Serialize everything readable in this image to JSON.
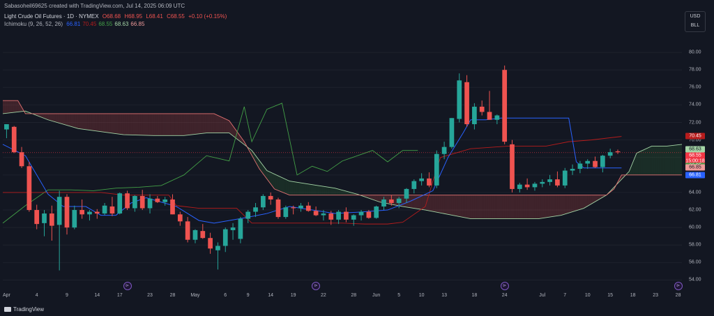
{
  "header": {
    "attribution": "Sabasoheil69625 created with TradingView.com, Jul 14, 2025 06:09 UTC"
  },
  "legend": {
    "symbol": "Light Crude Oil Futures · 1D · NYMEX",
    "open": "O68.68",
    "high": "H68.95",
    "low": "L68.41",
    "close": "C68.55",
    "change": "+0.10 (+0.15%)",
    "indicator": "Ichimoku (9, 26, 52, 26)",
    "ichi_values": [
      {
        "text": "66.81",
        "color": "#2962ff"
      },
      {
        "text": "70.45",
        "color": "#b71c1c"
      },
      {
        "text": "68.55",
        "color": "#43a047"
      },
      {
        "text": "68.63",
        "color": "#a5d6a7"
      },
      {
        "text": "66.85",
        "color": "#ef9a9a"
      }
    ]
  },
  "currency": {
    "unit": "USD",
    "sub": "BLL"
  },
  "price_axis": {
    "ticks": [
      "80.00",
      "78.00",
      "76.00",
      "74.00",
      "72.00",
      "70.00",
      "68.00",
      "66.00",
      "64.00",
      "62.00",
      "60.00",
      "58.00",
      "56.00",
      "54.00"
    ]
  },
  "price_badges": [
    {
      "text": "70.45",
      "value": 70.45,
      "color": "#b71c1c",
      "dark": false
    },
    {
      "text": "68.63",
      "value": 68.9,
      "color": "#a5d6a7",
      "dark": true
    },
    {
      "text": "68.55",
      "value": 68.2,
      "color": "#f23645",
      "dark": false
    },
    {
      "text": "15:00:18",
      "value": 67.55,
      "color": "#f23645",
      "dark": false
    },
    {
      "text": "68.55",
      "value": 67.0,
      "color": "#43a047",
      "dark": false
    },
    {
      "text": "66.85",
      "value": 66.85,
      "color": "#ef9a9a",
      "dark": true
    },
    {
      "text": "66.81",
      "value": 66.0,
      "color": "#2962ff",
      "dark": false
    }
  ],
  "time_axis": {
    "labels": [
      {
        "text": "Apr",
        "x": 0
      },
      {
        "text": "4",
        "x": 4
      },
      {
        "text": "9",
        "x": 8
      },
      {
        "text": "14",
        "x": 12
      },
      {
        "text": "17",
        "x": 15
      },
      {
        "text": "23",
        "x": 19
      },
      {
        "text": "28",
        "x": 22
      },
      {
        "text": "May",
        "x": 25
      },
      {
        "text": "6",
        "x": 29
      },
      {
        "text": "9",
        "x": 32
      },
      {
        "text": "14",
        "x": 35
      },
      {
        "text": "19",
        "x": 38
      },
      {
        "text": "22",
        "x": 42
      },
      {
        "text": "28",
        "x": 46
      },
      {
        "text": "Jun",
        "x": 49
      },
      {
        "text": "5",
        "x": 52
      },
      {
        "text": "10",
        "x": 55
      },
      {
        "text": "13",
        "x": 58
      },
      {
        "text": "18",
        "x": 62
      },
      {
        "text": "24",
        "x": 66
      },
      {
        "text": "Jul",
        "x": 71
      },
      {
        "text": "7",
        "x": 74
      },
      {
        "text": "10",
        "x": 77
      },
      {
        "text": "15",
        "x": 80
      },
      {
        "text": "18",
        "x": 83
      },
      {
        "text": "23",
        "x": 86
      },
      {
        "text": "28",
        "x": 89
      }
    ]
  },
  "footer": {
    "brand": "TradingView"
  },
  "chart_data": {
    "type": "candlestick",
    "x_index_range": [
      0,
      90
    ],
    "ylim": [
      53,
      82
    ],
    "candles": [
      [
        71.2,
        71.8,
        70.2,
        71.8
      ],
      [
        71.5,
        71.6,
        68.5,
        68.6
      ],
      [
        68.6,
        69.2,
        66.8,
        67.0
      ],
      [
        67.0,
        67.5,
        61.8,
        62.0
      ],
      [
        62.0,
        62.6,
        59.8,
        60.4
      ],
      [
        60.5,
        62.0,
        59.0,
        61.6
      ],
      [
        61.6,
        62.5,
        58.5,
        60.2
      ],
      [
        60.3,
        64.2,
        55.1,
        63.5
      ],
      [
        63.5,
        63.8,
        59.2,
        60.0
      ],
      [
        60.0,
        62.5,
        59.8,
        62.0
      ],
      [
        62.0,
        63.2,
        61.0,
        61.5
      ],
      [
        61.5,
        62.0,
        60.8,
        61.8
      ],
      [
        61.8,
        62.1,
        61.0,
        61.6
      ],
      [
        61.6,
        62.8,
        61.4,
        62.5
      ],
      [
        62.4,
        63.5,
        61.3,
        61.6
      ],
      [
        61.6,
        64.0,
        61.5,
        63.9
      ],
      [
        63.9,
        64.2,
        62.0,
        62.2
      ],
      [
        62.2,
        63.7,
        61.8,
        63.6
      ],
      [
        63.6,
        64.3,
        62.0,
        62.2
      ],
      [
        62.2,
        63.8,
        61.6,
        63.3
      ],
      [
        63.3,
        63.6,
        62.8,
        62.9
      ],
      [
        62.9,
        63.5,
        62.5,
        63.2
      ],
      [
        63.2,
        63.8,
        61.5,
        61.5
      ],
      [
        61.5,
        61.8,
        60.2,
        60.7
      ],
      [
        60.7,
        61.2,
        58.3,
        58.6
      ],
      [
        58.6,
        59.8,
        58.2,
        59.7
      ],
      [
        59.6,
        60.4,
        58.7,
        58.8
      ],
      [
        58.8,
        59.4,
        57.0,
        57.6
      ],
      [
        57.4,
        58.3,
        55.2,
        57.9
      ],
      [
        57.9,
        60.0,
        57.2,
        59.8
      ],
      [
        59.7,
        60.5,
        58.6,
        60.0
      ],
      [
        58.7,
        61.2,
        58.2,
        61.0
      ],
      [
        61.0,
        62.0,
        60.5,
        61.8
      ],
      [
        61.8,
        62.8,
        61.2,
        62.3
      ],
      [
        62.3,
        63.8,
        62.0,
        63.6
      ],
      [
        63.6,
        64.0,
        62.6,
        63.2
      ],
      [
        63.2,
        63.4,
        61.0,
        61.2
      ],
      [
        61.2,
        62.5,
        61.0,
        62.3
      ],
      [
        62.3,
        62.5,
        61.5,
        62.2
      ],
      [
        62.2,
        62.8,
        61.8,
        62.5
      ],
      [
        62.5,
        62.9,
        61.8,
        61.9
      ],
      [
        61.9,
        62.4,
        61.3,
        61.4
      ],
      [
        61.4,
        62.0,
        60.8,
        61.6
      ],
      [
        61.6,
        61.9,
        60.3,
        60.9
      ],
      [
        60.9,
        62.0,
        60.4,
        61.8
      ],
      [
        61.8,
        62.3,
        60.6,
        60.9
      ],
      [
        60.9,
        61.5,
        60.2,
        61.4
      ],
      [
        61.4,
        62.0,
        60.8,
        61.8
      ],
      [
        61.8,
        62.0,
        61.0,
        61.1
      ],
      [
        61.1,
        62.5,
        61.0,
        62.4
      ],
      [
        62.4,
        63.5,
        62.0,
        63.2
      ],
      [
        63.2,
        63.7,
        62.5,
        62.8
      ],
      [
        62.8,
        63.5,
        62.2,
        63.3
      ],
      [
        63.3,
        64.5,
        62.8,
        64.4
      ],
      [
        64.4,
        65.5,
        63.9,
        65.3
      ],
      [
        65.3,
        66.2,
        64.8,
        65.6
      ],
      [
        65.6,
        66.3,
        64.6,
        64.8
      ],
      [
        64.8,
        68.8,
        64.5,
        68.4
      ],
      [
        68.4,
        69.8,
        67.8,
        69.2
      ],
      [
        69.2,
        72.5,
        69.0,
        72.5
      ],
      [
        72.4,
        77.6,
        72.0,
        76.8
      ],
      [
        76.6,
        77.4,
        71.5,
        71.8
      ],
      [
        71.8,
        74.2,
        71.2,
        73.8
      ],
      [
        73.8,
        74.5,
        72.8,
        73.2
      ],
      [
        73.2,
        75.6,
        72.8,
        72.3
      ],
      [
        72.3,
        72.9,
        71.8,
        72.8
      ],
      [
        78.0,
        78.5,
        69.5,
        69.8
      ],
      [
        69.5,
        70.0,
        64.0,
        64.4
      ],
      [
        64.4,
        65.1,
        64.0,
        64.9
      ],
      [
        64.9,
        65.6,
        64.3,
        64.6
      ],
      [
        64.6,
        65.2,
        64.2,
        65.0
      ],
      [
        65.0,
        65.5,
        64.6,
        65.2
      ],
      [
        65.2,
        66.0,
        64.8,
        65.5
      ],
      [
        65.5,
        66.4,
        64.6,
        64.8
      ],
      [
        64.8,
        66.8,
        64.5,
        66.5
      ],
      [
        66.5,
        67.2,
        66.0,
        66.7
      ],
      [
        66.7,
        67.6,
        66.2,
        67.3
      ],
      [
        67.3,
        67.8,
        66.7,
        67.6
      ],
      [
        67.6,
        68.1,
        66.8,
        66.9
      ],
      [
        66.9,
        68.3,
        66.3,
        68.2
      ],
      [
        68.2,
        69.0,
        67.9,
        68.6
      ],
      [
        68.7,
        68.9,
        68.4,
        68.6
      ]
    ],
    "tenkan_sen": [
      [
        0,
        69.5
      ],
      [
        3,
        68.2
      ],
      [
        6,
        63.8
      ],
      [
        8,
        62.4
      ],
      [
        11,
        62.4
      ],
      [
        13,
        61.4
      ],
      [
        15,
        61.4
      ],
      [
        17,
        62.8
      ],
      [
        19,
        63.4
      ],
      [
        21,
        62.9
      ],
      [
        23,
        62.4
      ],
      [
        26,
        60.8
      ],
      [
        28,
        60.5
      ],
      [
        30,
        60.8
      ],
      [
        32,
        61.1
      ],
      [
        35,
        61.6
      ],
      [
        38,
        62.4
      ],
      [
        41,
        62.0
      ],
      [
        44,
        61.6
      ],
      [
        48,
        61.8
      ],
      [
        51,
        62.0
      ],
      [
        54,
        63.0
      ],
      [
        57,
        64.2
      ],
      [
        59,
        68.0
      ],
      [
        61,
        70.8
      ],
      [
        62,
        72.3
      ],
      [
        64,
        72.3
      ],
      [
        66,
        72.5
      ],
      [
        68,
        72.5
      ],
      [
        71,
        72.5
      ],
      [
        73,
        72.5
      ],
      [
        75,
        72.5
      ],
      [
        76,
        67.5
      ],
      [
        77,
        66.8
      ],
      [
        80,
        66.8
      ],
      [
        82,
        66.8
      ]
    ],
    "kijun_sen": [
      [
        0,
        64.0
      ],
      [
        13,
        64.0
      ],
      [
        16,
        63.7
      ],
      [
        22,
        63.7
      ],
      [
        23,
        62.5
      ],
      [
        26,
        62.2
      ],
      [
        31,
        62.2
      ],
      [
        33,
        60.5
      ],
      [
        38,
        60.5
      ],
      [
        45,
        60.5
      ],
      [
        48,
        60.4
      ],
      [
        51,
        60.4
      ],
      [
        53,
        60.6
      ],
      [
        56,
        62.4
      ],
      [
        57,
        65.3
      ],
      [
        58,
        68.0
      ],
      [
        62,
        69.0
      ],
      [
        67,
        69.3
      ],
      [
        72,
        69.3
      ],
      [
        75,
        69.8
      ],
      [
        78,
        70.0
      ],
      [
        82,
        70.4
      ]
    ],
    "chikou_span": [
      [
        0,
        60.5
      ],
      [
        3,
        62.5
      ],
      [
        6,
        64.3
      ],
      [
        9,
        64.3
      ],
      [
        12,
        64.2
      ],
      [
        15,
        64.5
      ],
      [
        18,
        64.6
      ],
      [
        21,
        64.8
      ],
      [
        24,
        66.0
      ],
      [
        27,
        68.2
      ],
      [
        30,
        67.6
      ],
      [
        32,
        73.8
      ],
      [
        33,
        69.8
      ],
      [
        35,
        73.5
      ],
      [
        37,
        74.2
      ],
      [
        39,
        66.0
      ],
      [
        41,
        67.0
      ],
      [
        43,
        66.4
      ],
      [
        45,
        67.6
      ],
      [
        47,
        68.2
      ],
      [
        49,
        68.8
      ],
      [
        51,
        67.5
      ],
      [
        53,
        68.8
      ],
      [
        55,
        68.8
      ]
    ],
    "senkou_span_a": [
      [
        0,
        73.0
      ],
      [
        3,
        73.3
      ],
      [
        6,
        72.3
      ],
      [
        10,
        71.3
      ],
      [
        16,
        70.6
      ],
      [
        20,
        70.5
      ],
      [
        24,
        70.5
      ],
      [
        27,
        70.8
      ],
      [
        30,
        70.8
      ],
      [
        33,
        68.8
      ],
      [
        35,
        66.5
      ],
      [
        38,
        65.3
      ],
      [
        41,
        64.9
      ],
      [
        44,
        64.5
      ],
      [
        47,
        63.8
      ],
      [
        50,
        62.9
      ],
      [
        53,
        62.4
      ],
      [
        56,
        62.0
      ],
      [
        59,
        61.5
      ],
      [
        62,
        61.0
      ],
      [
        65,
        61.0
      ],
      [
        68,
        61.0
      ],
      [
        71,
        61.0
      ],
      [
        74,
        61.4
      ],
      [
        77,
        62.2
      ],
      [
        80,
        63.7
      ],
      [
        83,
        66.4
      ],
      [
        84,
        68.5
      ],
      [
        86,
        69.3
      ],
      [
        88,
        69.3
      ],
      [
        90,
        69.5
      ]
    ],
    "senkou_span_b": [
      [
        0,
        74.5
      ],
      [
        2,
        74.5
      ],
      [
        3,
        73.0
      ],
      [
        7,
        73.0
      ],
      [
        12,
        73.0
      ],
      [
        18,
        73.0
      ],
      [
        24,
        73.0
      ],
      [
        28,
        73.0
      ],
      [
        30,
        72.2
      ],
      [
        32,
        69.8
      ],
      [
        34,
        66.7
      ],
      [
        36,
        64.4
      ],
      [
        38,
        63.7
      ],
      [
        44,
        63.7
      ],
      [
        50,
        63.7
      ],
      [
        56,
        63.7
      ],
      [
        62,
        63.7
      ],
      [
        68,
        63.7
      ],
      [
        74,
        63.7
      ],
      [
        80,
        63.7
      ],
      [
        81,
        64.4
      ],
      [
        82,
        66.0
      ],
      [
        84,
        66.0
      ],
      [
        90,
        66.0
      ]
    ],
    "current_price_line": 68.55
  },
  "events": {
    "symbol": "⊳",
    "positions": [
      16,
      41,
      66,
      89
    ]
  }
}
